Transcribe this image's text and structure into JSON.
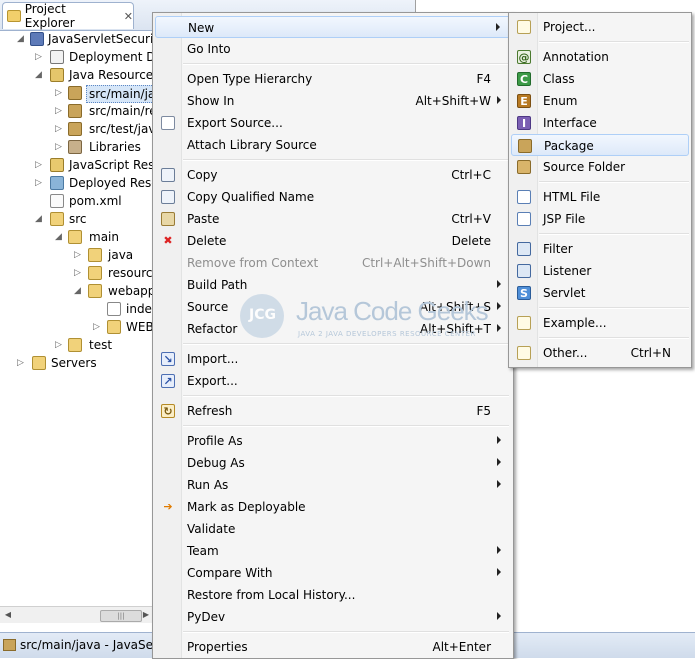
{
  "explorer": {
    "tab_title": "Project Explorer",
    "tab_close": "✕",
    "tree": [
      {
        "label": "JavaServletSecurity",
        "icon": "project-icon"
      },
      {
        "label": "Deployment De",
        "icon": "deployment-descriptor-icon"
      },
      {
        "label": "Java Resources",
        "icon": "java-resources-icon"
      },
      {
        "label": "src/main/ja",
        "icon": "source-folder-icon",
        "selected": true
      },
      {
        "label": "src/main/re",
        "icon": "source-folder-icon"
      },
      {
        "label": "src/test/java",
        "icon": "source-folder-icon"
      },
      {
        "label": "Libraries",
        "icon": "libraries-icon"
      },
      {
        "label": "JavaScript Reso",
        "icon": "javascript-icon"
      },
      {
        "label": "Deployed Resou",
        "icon": "deployed-resources-icon"
      },
      {
        "label": "pom.xml",
        "icon": "xml-file-icon"
      },
      {
        "label": "src",
        "icon": "folder-icon"
      },
      {
        "label": "main",
        "icon": "folder-icon"
      },
      {
        "label": "java",
        "icon": "folder-icon"
      },
      {
        "label": "resource",
        "icon": "folder-icon"
      },
      {
        "label": "webapp",
        "icon": "folder-icon"
      },
      {
        "label": "inde",
        "icon": "file-icon"
      },
      {
        "label": "WEB",
        "icon": "folder-icon"
      },
      {
        "label": "test",
        "icon": "folder-icon"
      },
      {
        "label": "Servers",
        "icon": "servers-icon"
      }
    ]
  },
  "status_bar": {
    "text": "src/main/java - JavaServl"
  },
  "context_menu": {
    "items": [
      {
        "label": "New",
        "submenu": true,
        "highlighted": true
      },
      {
        "label": "Go Into"
      },
      {
        "label": "Open Type Hierarchy",
        "shortcut": "F4"
      },
      {
        "label": "Show In",
        "shortcut": "Alt+Shift+W",
        "submenu": true
      },
      {
        "label": "Export Source...",
        "icon": "export-source-icon"
      },
      {
        "label": "Attach Library Source"
      },
      {
        "label": "Copy",
        "shortcut": "Ctrl+C",
        "icon": "copy-icon"
      },
      {
        "label": "Copy Qualified Name",
        "icon": "copy-qualified-name-icon"
      },
      {
        "label": "Paste",
        "shortcut": "Ctrl+V",
        "icon": "paste-icon"
      },
      {
        "label": "Delete",
        "shortcut": "Delete",
        "icon": "delete-icon"
      },
      {
        "label": "Remove from Context",
        "shortcut": "Ctrl+Alt+Shift+Down",
        "disabled": true
      },
      {
        "label": "Build Path",
        "submenu": true
      },
      {
        "label": "Source",
        "shortcut": "Alt+Shift+S",
        "submenu": true
      },
      {
        "label": "Refactor",
        "shortcut": "Alt+Shift+T",
        "submenu": true
      },
      {
        "label": "Import...",
        "icon": "import-icon"
      },
      {
        "label": "Export...",
        "icon": "export-icon"
      },
      {
        "label": "Refresh",
        "shortcut": "F5",
        "icon": "refresh-icon"
      },
      {
        "label": "Profile As",
        "submenu": true
      },
      {
        "label": "Debug As",
        "submenu": true
      },
      {
        "label": "Run As",
        "submenu": true
      },
      {
        "label": "Mark as Deployable",
        "icon": "deployable-icon"
      },
      {
        "label": "Validate"
      },
      {
        "label": "Team",
        "submenu": true
      },
      {
        "label": "Compare With",
        "submenu": true
      },
      {
        "label": "Restore from Local History..."
      },
      {
        "label": "PyDev",
        "submenu": true
      },
      {
        "label": "Properties",
        "shortcut": "Alt+Enter"
      }
    ]
  },
  "new_submenu": {
    "items": [
      {
        "label": "Project...",
        "icon": "project-wizard-icon"
      },
      {
        "label": "Annotation",
        "icon": "annotation-icon"
      },
      {
        "label": "Class",
        "icon": "class-icon"
      },
      {
        "label": "Enum",
        "icon": "enum-icon"
      },
      {
        "label": "Interface",
        "icon": "interface-icon"
      },
      {
        "label": "Package",
        "icon": "package-icon",
        "highlighted": true
      },
      {
        "label": "Source Folder",
        "icon": "source-folder-icon"
      },
      {
        "label": "HTML File",
        "icon": "html-file-icon"
      },
      {
        "label": "JSP File",
        "icon": "jsp-file-icon"
      },
      {
        "label": "Filter",
        "icon": "filter-icon"
      },
      {
        "label": "Listener",
        "icon": "listener-icon"
      },
      {
        "label": "Servlet",
        "icon": "servlet-icon"
      },
      {
        "label": "Example...",
        "icon": "example-icon"
      },
      {
        "label": "Other...",
        "shortcut": "Ctrl+N",
        "icon": "other-wizard-icon"
      }
    ]
  },
  "watermark": {
    "logo_letters": "JCG",
    "brand": "Java Code Geeks",
    "tagline": "JAVA 2 JAVA DEVELOPERS RESOURCE CENTER"
  }
}
